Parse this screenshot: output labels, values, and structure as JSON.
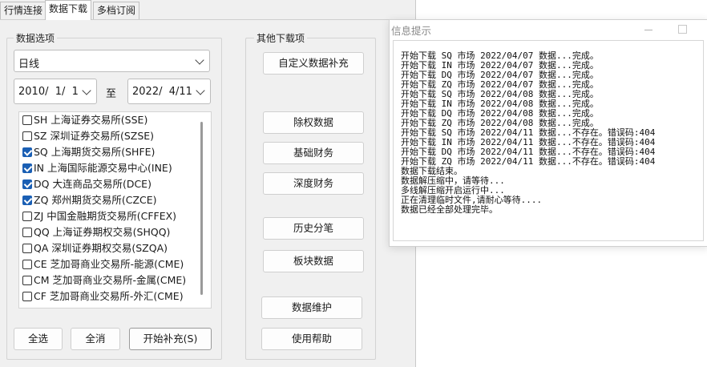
{
  "tabs": [
    "行情连接",
    "数据下载",
    "多档订阅"
  ],
  "active_tab": 1,
  "data_options": {
    "title": "数据选项",
    "period": "日线",
    "start_date": "2010/  1/  1",
    "to_label": "至",
    "end_date": "2022/  4/11",
    "exchanges": [
      {
        "label": "SH 上海证券交易所(SSE)",
        "checked": false
      },
      {
        "label": "SZ 深圳证券交易所(SZSE)",
        "checked": false
      },
      {
        "label": "SQ 上海期货交易所(SHFE)",
        "checked": true
      },
      {
        "label": "IN 上海国际能源交易中心(INE)",
        "checked": true
      },
      {
        "label": "DQ 大连商品交易所(DCE)",
        "checked": true
      },
      {
        "label": "ZQ 郑州期货交易所(CZCE)",
        "checked": true
      },
      {
        "label": "ZJ 中国金融期货交易所(CFFEX)",
        "checked": false
      },
      {
        "label": "QQ 上海证券期权交易(SHQQ)",
        "checked": false
      },
      {
        "label": "QA 深圳证券期权交易(SZQA)",
        "checked": false
      },
      {
        "label": "CE 芝加哥商业交易所-能源(CME)",
        "checked": false
      },
      {
        "label": "CM 芝加哥商业交易所-金属(CME)",
        "checked": false
      },
      {
        "label": "CF 芝加哥商业交易所-外汇(CME)",
        "checked": false
      }
    ],
    "select_all": "全选",
    "clear_all": "全消",
    "start_fill": "开始补充(S)"
  },
  "other_downloads": {
    "title": "其他下载项",
    "buttons": [
      "自定义数据补充",
      "除权数据",
      "基础财务",
      "深度财务",
      "历史分笔",
      "板块数据",
      "数据维护",
      "使用帮助"
    ]
  },
  "message_window": {
    "title": "信息提示",
    "lines": [
      "开始下载 SQ 市场 2022/04/07 数据...完成。",
      "开始下载 IN 市场 2022/04/07 数据...完成。",
      "开始下载 DQ 市场 2022/04/07 数据...完成。",
      "开始下载 ZQ 市场 2022/04/07 数据...完成。",
      "开始下载 SQ 市场 2022/04/08 数据...完成。",
      "开始下载 IN 市场 2022/04/08 数据...完成。",
      "开始下载 DQ 市场 2022/04/08 数据...完成。",
      "开始下载 ZQ 市场 2022/04/08 数据...完成。",
      "开始下载 SQ 市场 2022/04/11 数据...不存在。错误码:404",
      "开始下载 IN 市场 2022/04/11 数据...不存在。错误码:404",
      "开始下载 DQ 市场 2022/04/11 数据...不存在。错误码:404",
      "开始下载 ZQ 市场 2022/04/11 数据...不存在。错误码:404",
      "数据下载结束。",
      "数据解压缩中，请等待...",
      "多线解压缩开启运行中...",
      "正在清理临时文件,请耐心等待....",
      "数据已经全部处理完毕。"
    ]
  }
}
